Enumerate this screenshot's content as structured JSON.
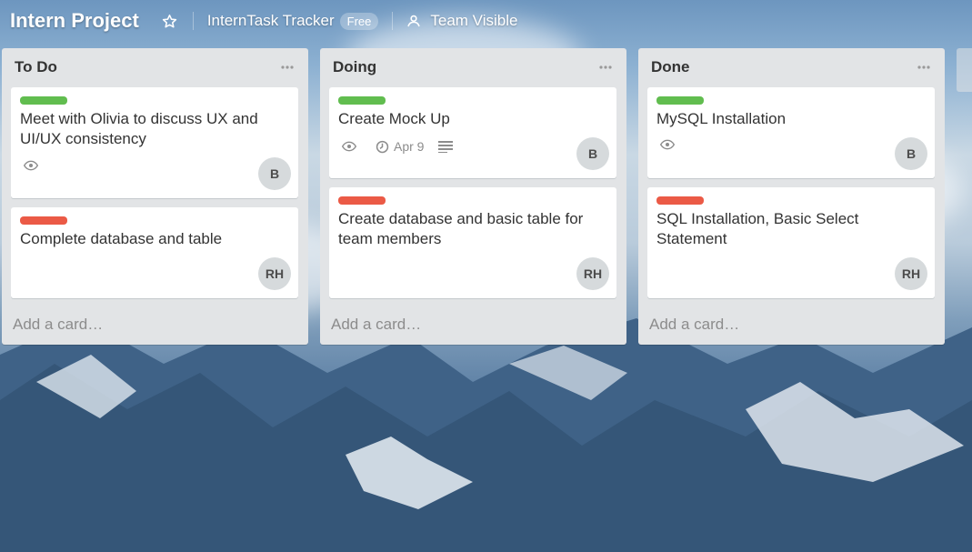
{
  "header": {
    "board_title": "Intern Project",
    "org_name": "InternTask Tracker",
    "org_badge": "Free",
    "visibility": "Team Visible"
  },
  "colors": {
    "label_green": "#61bd4f",
    "label_red": "#eb5a46"
  },
  "lists": [
    {
      "title": "To Do",
      "add_card": "Add a card…",
      "cards": [
        {
          "label": "green",
          "title": "Meet with Olivia to discuss UX and UI/UX consistency",
          "watch": true,
          "avatar": "B"
        },
        {
          "label": "red",
          "title": "Complete database and table",
          "avatar": "RH"
        }
      ]
    },
    {
      "title": "Doing",
      "add_card": "Add a card…",
      "cards": [
        {
          "label": "green",
          "title": "Create Mock Up",
          "watch": true,
          "due": "Apr 9",
          "description": true,
          "avatar": "B"
        },
        {
          "label": "red",
          "title": "Create database and basic table for team members",
          "avatar": "RH"
        }
      ]
    },
    {
      "title": "Done",
      "add_card": "Add a card…",
      "cards": [
        {
          "label": "green",
          "title": "MySQL Installation",
          "watch": true,
          "avatar": "B"
        },
        {
          "label": "red",
          "title": "SQL Installation, Basic Select Statement",
          "avatar": "RH"
        }
      ]
    }
  ]
}
